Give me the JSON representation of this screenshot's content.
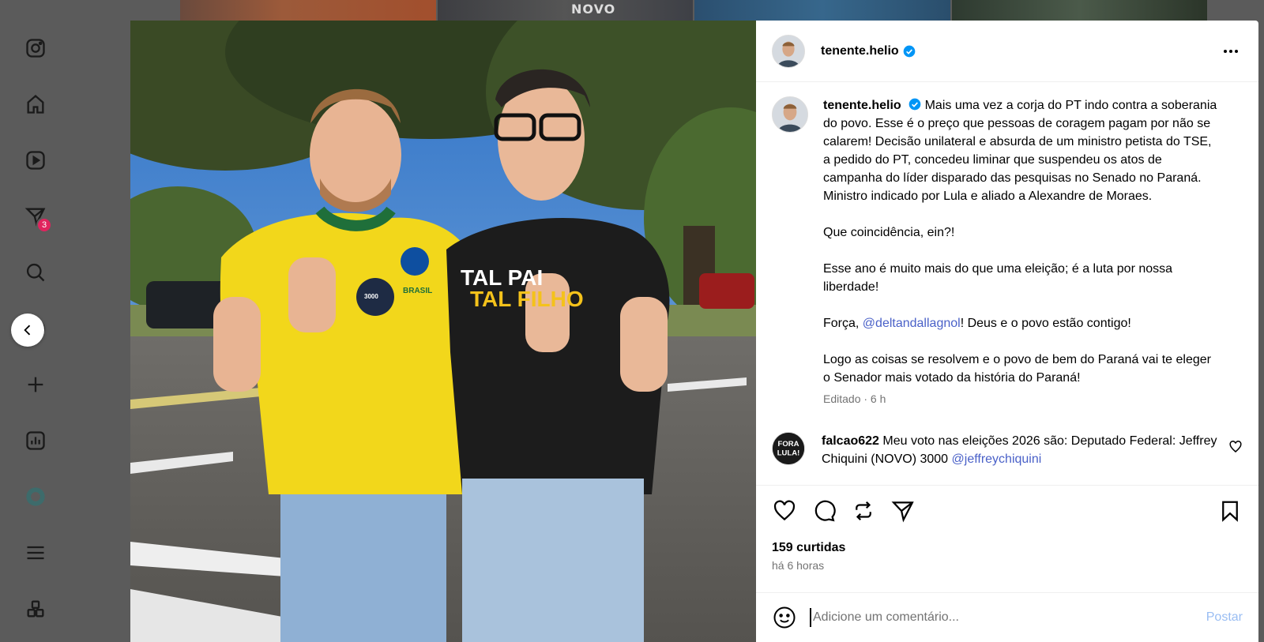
{
  "background": {
    "logo_text": "NOVO"
  },
  "nav": {
    "notifications_badge": "3",
    "items": [
      "instagram-icon",
      "home-icon",
      "reels-icon",
      "messages-icon",
      "search-icon",
      "explore-icon",
      "create-icon",
      "dashboard-icon",
      "threads-icon",
      "menu-icon",
      "more-apps-icon"
    ]
  },
  "post": {
    "username": "tenente.helio",
    "caption": {
      "first": "Mais uma vez a corja do PT indo contra a soberania do povo. Esse é o preço que pessoas de coragem pagam por não se calarem! Decisão unilateral e absurda de um ministro petista do TSE, a pedido do PT, concedeu liminar que suspendeu os atos de campanha do líder disparado das pesquisas no Senado no Paraná. Ministro indicado por Lula e aliado a Alexandre de Moraes.",
      "p2": "Que coincidência, ein?!",
      "p3": "Esse ano é muito mais do que uma eleição; é a luta por nossa liberdade!",
      "p4_prefix": "Força, ",
      "p4_mention": "@deltandallagnol",
      "p4_suffix": "! Deus e o povo estão contigo!",
      "p5": "Logo as coisas se resolvem e o povo de bem do Paraná vai te eleger o Senador mais votado da história do Paraná!",
      "meta": "Editado · 6 h"
    },
    "comment": {
      "username": "falcao622",
      "text": "Meu voto nas eleições 2026 são: Deputado Federal: Jeffrey Chiquini (NOVO) 3000",
      "mention": "@jeffreychiquini",
      "avatar_text": "FORA LULA!"
    },
    "likes": "159 curtidas",
    "time": "há 6 horas",
    "comment_placeholder": "Adicione um comentário...",
    "post_label": "Postar",
    "shirt_text_1": "TAL PAI",
    "shirt_text_2": "TAL FILHO",
    "badge_number": "3000",
    "jersey_text": "BRASIL"
  },
  "colors": {
    "verified": "#0095f6",
    "mention": "#4a61c8",
    "post_button": "#99bdf3",
    "badge": "#e0245e"
  }
}
